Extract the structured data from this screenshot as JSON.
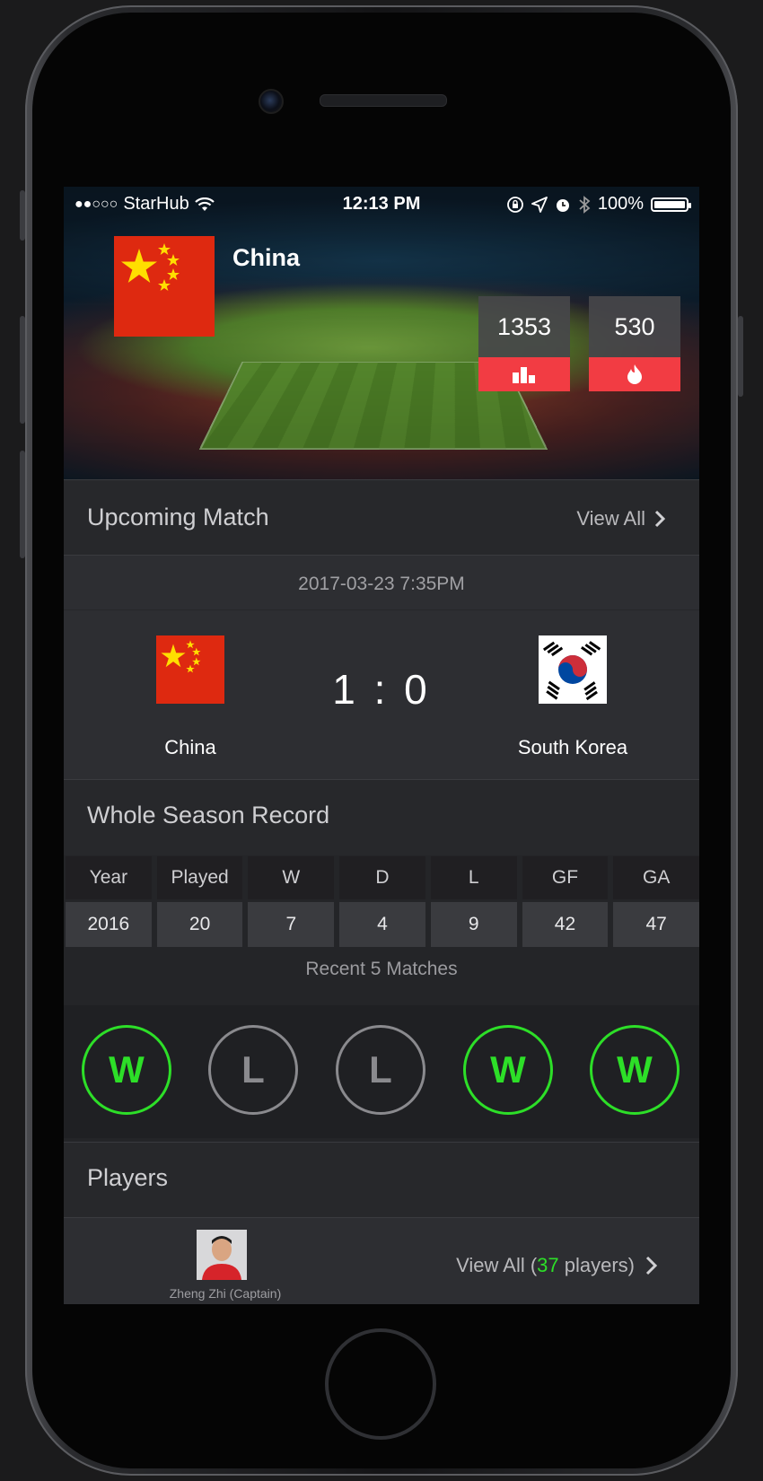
{
  "status_bar": {
    "signal": "●●○○○",
    "carrier": "StarHub",
    "time": "12:13 PM",
    "battery": "100%"
  },
  "team": {
    "name": "China",
    "stat_1": "1353",
    "stat_2": "530",
    "stat_1_icon": "bar-chart-icon",
    "stat_2_icon": "flame-icon"
  },
  "upcoming": {
    "title": "Upcoming Match",
    "view_all": "View All",
    "date": "2017-03-23 7:35PM",
    "home_team": "China",
    "away_team": "South Korea",
    "score": "1 : 0"
  },
  "season_record": {
    "title": "Whole Season Record",
    "headers": [
      "Year",
      "Played",
      "W",
      "D",
      "L",
      "GF",
      "GA"
    ],
    "values": [
      "2016",
      "20",
      "7",
      "4",
      "9",
      "42",
      "47"
    ]
  },
  "recent": {
    "label": "Recent 5 Matches",
    "results": [
      "W",
      "L",
      "L",
      "W",
      "W"
    ]
  },
  "players": {
    "title": "Players",
    "captain": "Zheng Zhi (Captain)",
    "view_all_prefix": "View All (",
    "count": "37",
    "view_all_suffix": " players)"
  },
  "colors": {
    "accent_red": "#f23c43",
    "win_green": "#2ddf28",
    "loss_gray": "#8a8a8e"
  }
}
